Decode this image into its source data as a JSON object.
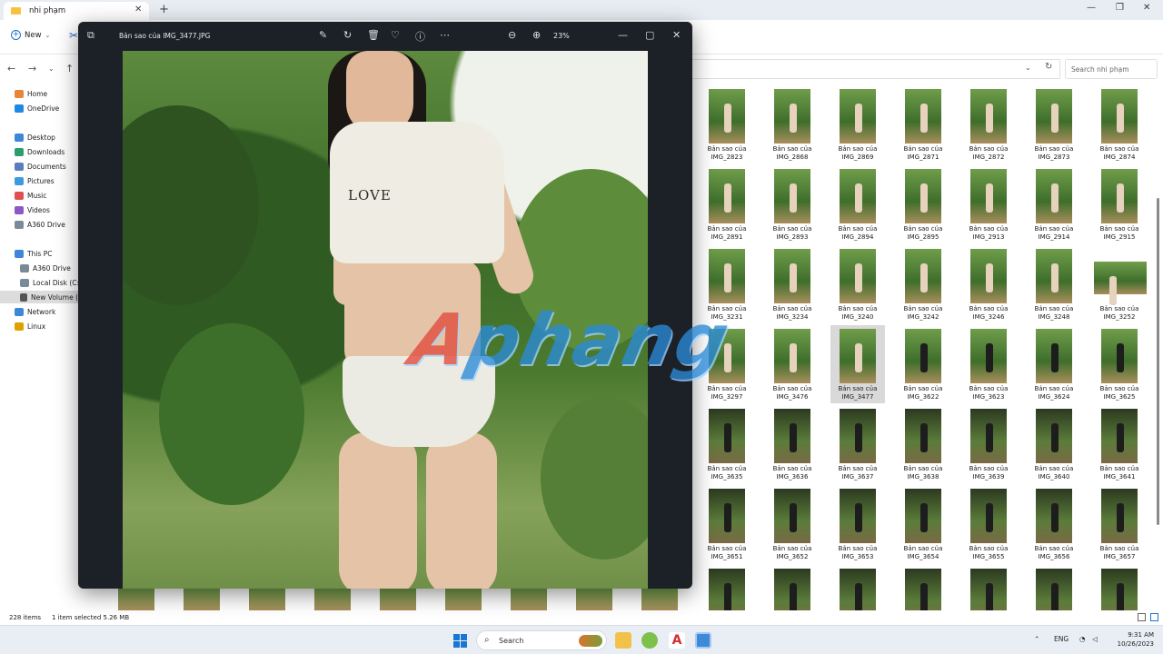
{
  "explorer": {
    "tab_title": "nhi phạm",
    "new_label": "New",
    "search_placeholder": "Search nhi phạm",
    "sidebar": [
      {
        "label": "Home",
        "icon": "home-icon",
        "color": "#e8853b"
      },
      {
        "label": "OneDrive",
        "icon": "cloud-icon",
        "color": "#1e88e5"
      },
      {
        "label": "Desktop",
        "icon": "desktop-icon",
        "color": "#3d86d8"
      },
      {
        "label": "Downloads",
        "icon": "download-icon",
        "color": "#2b9e6b"
      },
      {
        "label": "Documents",
        "icon": "document-icon",
        "color": "#5b7dbd"
      },
      {
        "label": "Pictures",
        "icon": "pictures-icon",
        "color": "#3c9be0"
      },
      {
        "label": "Music",
        "icon": "music-icon",
        "color": "#e05050"
      },
      {
        "label": "Videos",
        "icon": "video-icon",
        "color": "#8d57c9"
      },
      {
        "label": "A360 Drive",
        "icon": "drive-icon",
        "color": "#7a8a99"
      },
      {
        "label": "This PC",
        "icon": "pc-icon",
        "color": "#3d86d8"
      },
      {
        "label": "A360 Drive",
        "icon": "drive-icon",
        "color": "#7a8a99"
      },
      {
        "label": "Local Disk (C:)",
        "icon": "disk-icon",
        "color": "#7a8a99"
      },
      {
        "label": "New Volume (",
        "icon": "disk-icon",
        "color": "#555555"
      },
      {
        "label": "Network",
        "icon": "network-icon",
        "color": "#3d86d8"
      },
      {
        "label": "Linux",
        "icon": "linux-icon",
        "color": "#e0a000"
      }
    ],
    "file_prefix": "Bản sao của",
    "files": [
      "IMG_2823",
      "IMG_2868",
      "IMG_2869",
      "IMG_2871",
      "IMG_2872",
      "IMG_2873",
      "IMG_2874",
      "IMG_2891",
      "IMG_2893",
      "IMG_2894",
      "IMG_2895",
      "IMG_2913",
      "IMG_2914",
      "IMG_2915",
      "IMG_3231",
      "IMG_3234",
      "IMG_3240",
      "IMG_3242",
      "IMG_3246",
      "IMG_3248",
      "IMG_3252",
      "IMG_3297",
      "IMG_3476",
      "IMG_3477",
      "IMG_3622",
      "IMG_3623",
      "IMG_3624",
      "IMG_3625",
      "IMG_3635",
      "IMG_3636",
      "IMG_3637",
      "IMG_3638",
      "IMG_3639",
      "IMG_3640",
      "IMG_3641",
      "IMG_3651",
      "IMG_3652",
      "IMG_3653",
      "IMG_3654",
      "IMG_3655",
      "IMG_3656",
      "IMG_3657",
      "",
      "",
      "",
      "",
      "",
      "",
      ""
    ],
    "selected_file": "IMG_3477",
    "status": {
      "count": "228 items",
      "selection": "1 item selected  5.26 MB"
    }
  },
  "viewer": {
    "title": "Bản sao của IMG_3477.JPG",
    "zoom": "23%",
    "shirt_text": "LOVE",
    "watermark": "Aphang"
  },
  "taskbar": {
    "search_label": "Search",
    "language": "ENG",
    "time": "9:31 AM",
    "date": "10/26/2023",
    "accent": "#1976d2"
  }
}
